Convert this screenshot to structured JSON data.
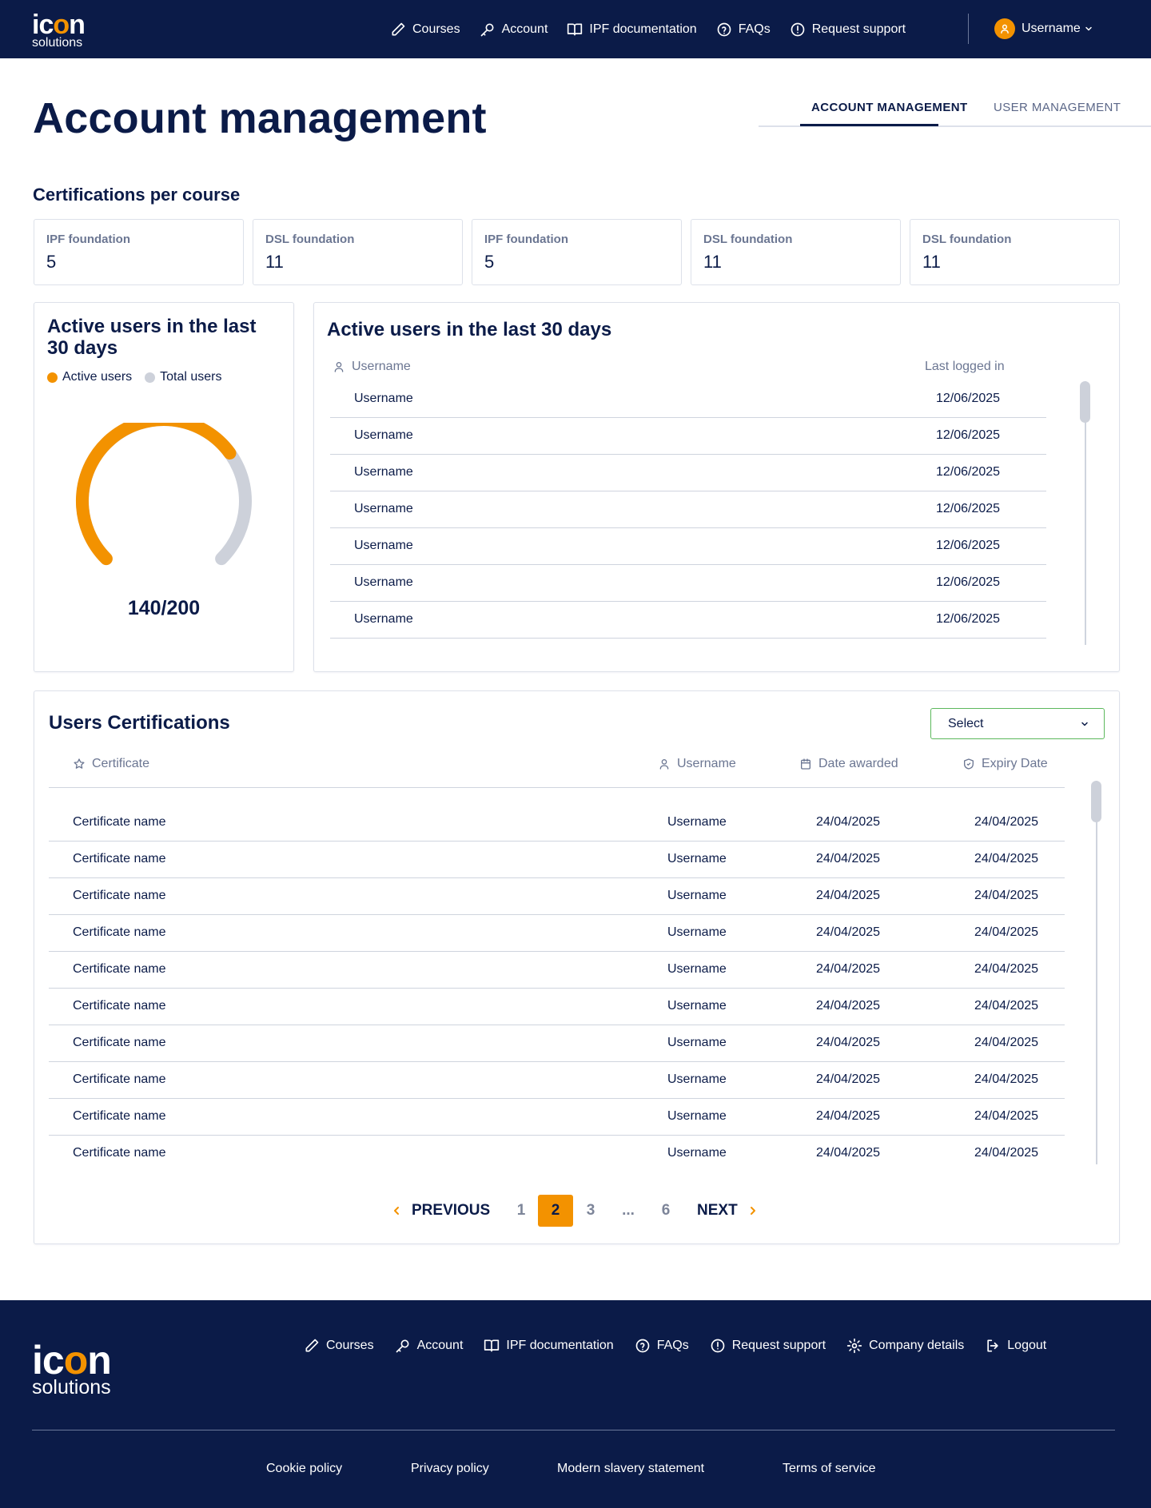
{
  "brand": {
    "logo_word_a": "ic",
    "logo_word_o": "o",
    "logo_word_b": "n",
    "logo_sub": "solutions"
  },
  "colors": {
    "navy": "#0b1b48",
    "accent": "#f39200",
    "muted": "#cdd1da",
    "select_border": "#5cb85c"
  },
  "nav": [
    {
      "label": "Courses",
      "icon": "pencil-icon"
    },
    {
      "label": "Account",
      "icon": "key-icon"
    },
    {
      "label": "IPF documentation",
      "icon": "book-icon"
    },
    {
      "label": "FAQs",
      "icon": "question-icon"
    },
    {
      "label": "Request support",
      "icon": "alert-circle-icon"
    }
  ],
  "user": {
    "name": "Username"
  },
  "page": {
    "title": "Account management"
  },
  "tabs": [
    {
      "label": "ACCOUNT MANAGEMENT",
      "active": true
    },
    {
      "label": "USER MANAGEMENT",
      "active": false
    }
  ],
  "certifications_per_course": {
    "title": "Certifications per course",
    "cards": [
      {
        "label": "IPF foundation",
        "value": "5"
      },
      {
        "label": "DSL foundation",
        "value": "11"
      },
      {
        "label": "IPF foundation",
        "value": "5"
      },
      {
        "label": "DSL foundation",
        "value": "11"
      },
      {
        "label": "DSL foundation",
        "value": "11"
      }
    ]
  },
  "gauge": {
    "title": "Active users in the last 30 days",
    "legend": [
      {
        "label": "Active users",
        "color": "#f39200"
      },
      {
        "label": "Total users",
        "color": "#cdd1da"
      }
    ],
    "value_label": "140/200",
    "active": 140,
    "total": 200
  },
  "active_users": {
    "title": "Active users in the last 30 days",
    "col_username": "Username",
    "col_last_login": "Last logged in",
    "rows": [
      {
        "username": "Username",
        "last": "12/06/2025"
      },
      {
        "username": "Username",
        "last": "12/06/2025"
      },
      {
        "username": "Username",
        "last": "12/06/2025"
      },
      {
        "username": "Username",
        "last": "12/06/2025"
      },
      {
        "username": "Username",
        "last": "12/06/2025"
      },
      {
        "username": "Username",
        "last": "12/06/2025"
      },
      {
        "username": "Username",
        "last": "12/06/2025"
      }
    ]
  },
  "certs": {
    "title": "Users Certifications",
    "select_label": "Select",
    "col_certificate": "Certificate",
    "col_username": "Username",
    "col_awarded": "Date awarded",
    "col_expiry": "Expiry Date",
    "rows": [
      {
        "cert": "Certificate name",
        "user": "Username",
        "awarded": "24/04/2025",
        "expiry": "24/04/2025"
      },
      {
        "cert": "Certificate name",
        "user": "Username",
        "awarded": "24/04/2025",
        "expiry": "24/04/2025"
      },
      {
        "cert": "Certificate name",
        "user": "Username",
        "awarded": "24/04/2025",
        "expiry": "24/04/2025"
      },
      {
        "cert": "Certificate name",
        "user": "Username",
        "awarded": "24/04/2025",
        "expiry": "24/04/2025"
      },
      {
        "cert": "Certificate name",
        "user": "Username",
        "awarded": "24/04/2025",
        "expiry": "24/04/2025"
      },
      {
        "cert": "Certificate name",
        "user": "Username",
        "awarded": "24/04/2025",
        "expiry": "24/04/2025"
      },
      {
        "cert": "Certificate name",
        "user": "Username",
        "awarded": "24/04/2025",
        "expiry": "24/04/2025"
      },
      {
        "cert": "Certificate name",
        "user": "Username",
        "awarded": "24/04/2025",
        "expiry": "24/04/2025"
      },
      {
        "cert": "Certificate name",
        "user": "Username",
        "awarded": "24/04/2025",
        "expiry": "24/04/2025"
      },
      {
        "cert": "Certificate name",
        "user": "Username",
        "awarded": "24/04/2025",
        "expiry": "24/04/2025"
      }
    ]
  },
  "pagination": {
    "prev": "PREVIOUS",
    "next": "NEXT",
    "pages": [
      "1",
      "2",
      "3",
      "...",
      "6"
    ],
    "current": "2"
  },
  "footer": {
    "nav": [
      {
        "label": "Courses",
        "icon": "pencil-icon"
      },
      {
        "label": "Account",
        "icon": "key-icon"
      },
      {
        "label": "IPF documentation",
        "icon": "book-icon"
      },
      {
        "label": "FAQs",
        "icon": "question-icon"
      },
      {
        "label": "Request support",
        "icon": "alert-circle-icon"
      },
      {
        "label": "Company details",
        "icon": "gear-icon"
      },
      {
        "label": "Logout",
        "icon": "logout-icon"
      }
    ],
    "links": [
      "Cookie policy",
      "Privacy policy",
      "Modern slavery statement",
      "Terms of service"
    ]
  }
}
